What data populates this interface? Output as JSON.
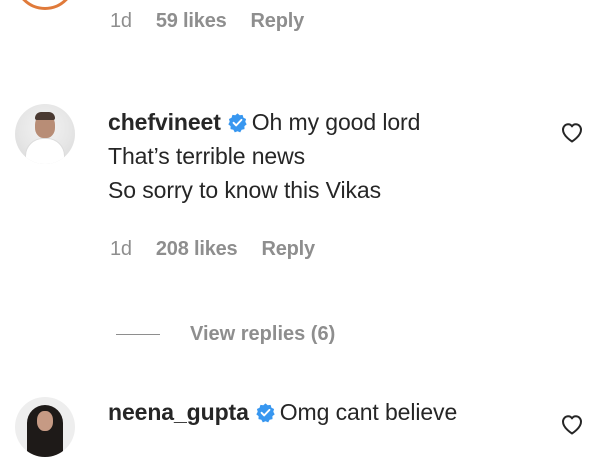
{
  "top_comment": {
    "time": "1d",
    "likes": "59 likes",
    "reply_label": "Reply"
  },
  "comments": [
    {
      "username": "chefvineet",
      "verified": true,
      "text_lines": [
        "Oh my good lord",
        "That’s terrible news",
        "So sorry to know this Vikas"
      ],
      "time": "1d",
      "likes": "208 likes",
      "reply_label": "Reply"
    },
    {
      "username": "neena_gupta",
      "verified": true,
      "text_lines": [
        "Omg cant believe"
      ]
    }
  ],
  "view_replies": {
    "label": "View replies (6)"
  },
  "icons": {
    "verified": "verified-badge-icon",
    "like": "heart-icon"
  },
  "colors": {
    "verified": "#3897f0",
    "muted": "#8e8e8e",
    "text": "#262626"
  }
}
